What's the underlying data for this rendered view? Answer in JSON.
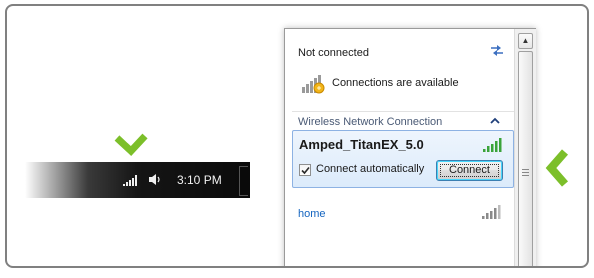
{
  "taskbar": {
    "clock": "3:10 PM",
    "icons": [
      "signal-bars-icon",
      "volume-icon"
    ]
  },
  "popup": {
    "status_title": "Not connected",
    "availability_text": "Connections are available",
    "section_header": "Wireless Network Connection",
    "networks": [
      {
        "name": "Amped_TitanEX_5.0",
        "selected": true,
        "connect_automatically_label": "Connect automatically",
        "connect_automatically_checked": true,
        "connect_button_label": "Connect",
        "signal_color": "#3aa33a"
      },
      {
        "name": "home",
        "selected": false,
        "signal_color": "#8a8a8a"
      }
    ]
  },
  "colors": {
    "accent_green": "#7cbf2a",
    "selection_border": "#8db2e3",
    "link_blue": "#1565c0"
  }
}
